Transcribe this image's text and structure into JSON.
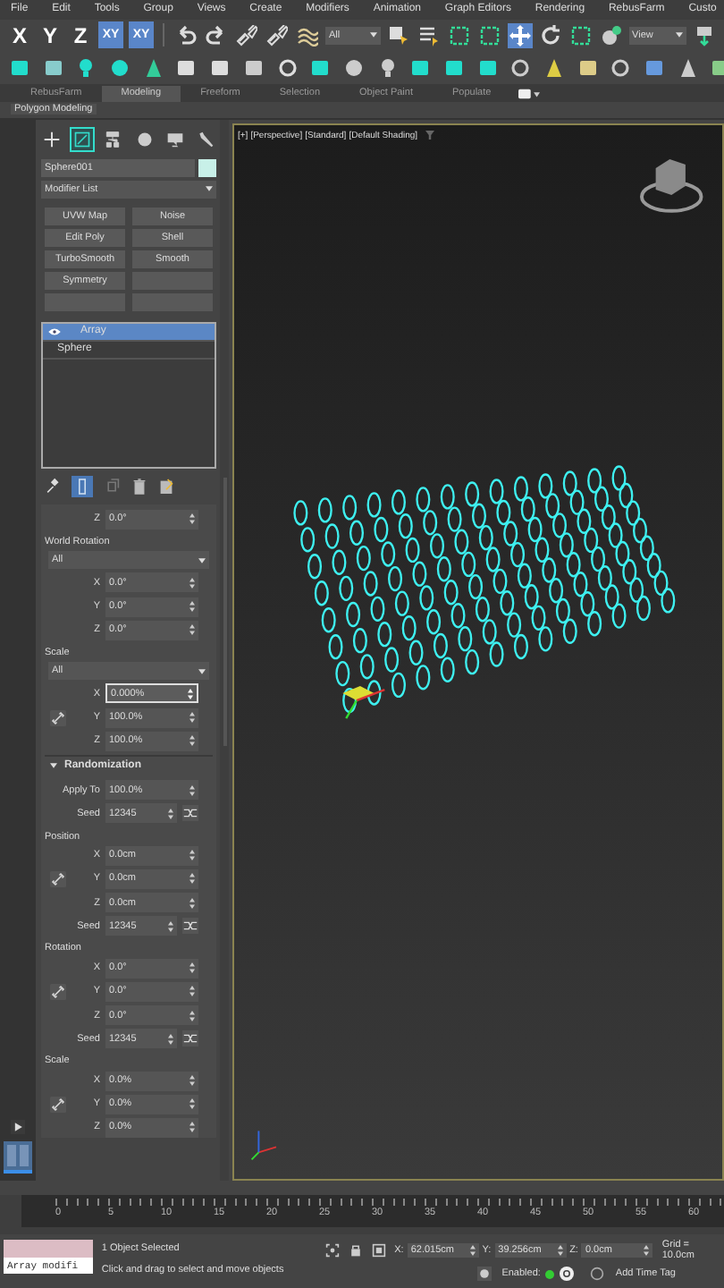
{
  "menu": [
    "File",
    "Edit",
    "Tools",
    "Group",
    "Views",
    "Create",
    "Modifiers",
    "Animation",
    "Graph Editors",
    "Rendering",
    "RebusFarm",
    "Custo"
  ],
  "main_toolbar": {
    "axis_buttons": [
      {
        "label": "X",
        "selected": false
      },
      {
        "label": "Y",
        "selected": false
      },
      {
        "label": "Z",
        "selected": false
      },
      {
        "label": "XY",
        "selected": true
      },
      {
        "label": "XY",
        "selected": true
      }
    ],
    "selection_filter": "All",
    "reference_coordinate": "View"
  },
  "ribbon": {
    "tabs": [
      {
        "label": "RebusFarm",
        "selected": false
      },
      {
        "label": "Modeling",
        "selected": true
      },
      {
        "label": "Freeform",
        "selected": false
      },
      {
        "label": "Selection",
        "selected": false
      },
      {
        "label": "Object Paint",
        "selected": false
      },
      {
        "label": "Populate",
        "selected": false
      }
    ],
    "panel": "Polygon Modeling"
  },
  "command_panel": {
    "tabs": [
      {
        "kind": "create",
        "selected": false
      },
      {
        "kind": "modify",
        "selected": true
      },
      {
        "kind": "hierarchy",
        "selected": false
      },
      {
        "kind": "motion",
        "selected": false
      },
      {
        "kind": "display",
        "selected": false
      },
      {
        "kind": "utilities",
        "selected": false
      }
    ],
    "object_name": "Sphere001",
    "modifier_list": "Modifier List",
    "buttons": [
      {
        "kind": "set",
        "label": "UVW Map"
      },
      {
        "kind": "set",
        "label": "Noise"
      },
      {
        "kind": "set",
        "label": "Edit Poly"
      },
      {
        "kind": "set",
        "label": "Shell"
      },
      {
        "kind": "set",
        "label": "TurboSmooth"
      },
      {
        "kind": "set",
        "label": "Smooth"
      },
      {
        "kind": "set",
        "label": "Symmetry"
      },
      {
        "kind": "empty"
      },
      {
        "kind": "empty"
      },
      {
        "kind": "empty"
      }
    ],
    "stack": [
      {
        "kind": "modifier",
        "label": "Array",
        "selected": true,
        "on": true
      },
      {
        "kind": "base",
        "label": "Sphere",
        "selected": false
      }
    ],
    "stack_tools": [
      {
        "kind": "pin",
        "selected": false
      },
      {
        "kind": "end-result",
        "selected": true
      },
      {
        "kind": "unique",
        "selected": false
      },
      {
        "kind": "remove",
        "selected": false
      },
      {
        "kind": "configure",
        "selected": false
      }
    ]
  },
  "params": [
    {
      "kind": "spinner",
      "label": "Z",
      "value": "0.0°"
    },
    {
      "kind": "heading",
      "text": "World Rotation"
    },
    {
      "kind": "dropdown",
      "value": "All"
    },
    {
      "kind": "xyz",
      "link": false,
      "rows": [
        {
          "label": "X",
          "value": "0.0°",
          "active": false
        },
        {
          "label": "Y",
          "value": "0.0°",
          "active": false
        },
        {
          "label": "Z",
          "value": "0.0°",
          "active": false
        }
      ]
    },
    {
      "kind": "heading",
      "text": "Scale"
    },
    {
      "kind": "dropdown",
      "value": "All"
    },
    {
      "kind": "xyz",
      "link": true,
      "rows": [
        {
          "label": "X",
          "value": "0.000%",
          "active": true
        },
        {
          "label": "Y",
          "value": "100.0%",
          "active": false
        },
        {
          "label": "Z",
          "value": "100.0%",
          "active": false
        }
      ]
    },
    {
      "kind": "rollout",
      "text": "Randomization",
      "expanded": true
    },
    {
      "kind": "spinner",
      "label": "Apply To",
      "value": "100.0%"
    },
    {
      "kind": "seed",
      "label": "Seed",
      "value": "12345"
    },
    {
      "kind": "heading",
      "text": "Position"
    },
    {
      "kind": "xyz",
      "link": true,
      "rows": [
        {
          "label": "X",
          "value": "0.0cm",
          "active": false
        },
        {
          "label": "Y",
          "value": "0.0cm",
          "active": false
        },
        {
          "label": "Z",
          "value": "0.0cm",
          "active": false
        }
      ]
    },
    {
      "kind": "seed",
      "label": "Seed",
      "value": "12345"
    },
    {
      "kind": "heading",
      "text": "Rotation"
    },
    {
      "kind": "xyz",
      "link": true,
      "rows": [
        {
          "label": "X",
          "value": "0.0°",
          "active": false
        },
        {
          "label": "Y",
          "value": "0.0°",
          "active": false
        },
        {
          "label": "Z",
          "value": "0.0°",
          "active": false
        }
      ]
    },
    {
      "kind": "seed",
      "label": "Seed",
      "value": "12345"
    },
    {
      "kind": "heading",
      "text": "Scale"
    },
    {
      "kind": "xyz",
      "link": true,
      "rows": [
        {
          "label": "X",
          "value": "0.0%",
          "active": false
        },
        {
          "label": "Y",
          "value": "0.0%",
          "active": false
        },
        {
          "label": "Z",
          "value": "0.0%",
          "active": false
        }
      ]
    }
  ],
  "viewport": {
    "labels": [
      "[+]",
      "[Perspective]",
      "[Standard]",
      "[Default Shading]"
    ]
  },
  "timeline": {
    "ticks": [
      "0",
      "5",
      "10",
      "15",
      "20",
      "25",
      "30",
      "35",
      "40",
      "45",
      "50",
      "55",
      "60"
    ]
  },
  "status": {
    "listener": "Array modifi",
    "selection": "1 Object Selected",
    "prompt": "Click and drag to select and move objects",
    "coords": [
      {
        "label": "X:",
        "value": "62.015cm"
      },
      {
        "label": "Y:",
        "value": "39.256cm"
      },
      {
        "label": "Z:",
        "value": "0.0cm"
      }
    ],
    "grid": "Grid = 10.0cm",
    "enabled_label": "Enabled:",
    "time_tag": "Add Time Tag"
  }
}
